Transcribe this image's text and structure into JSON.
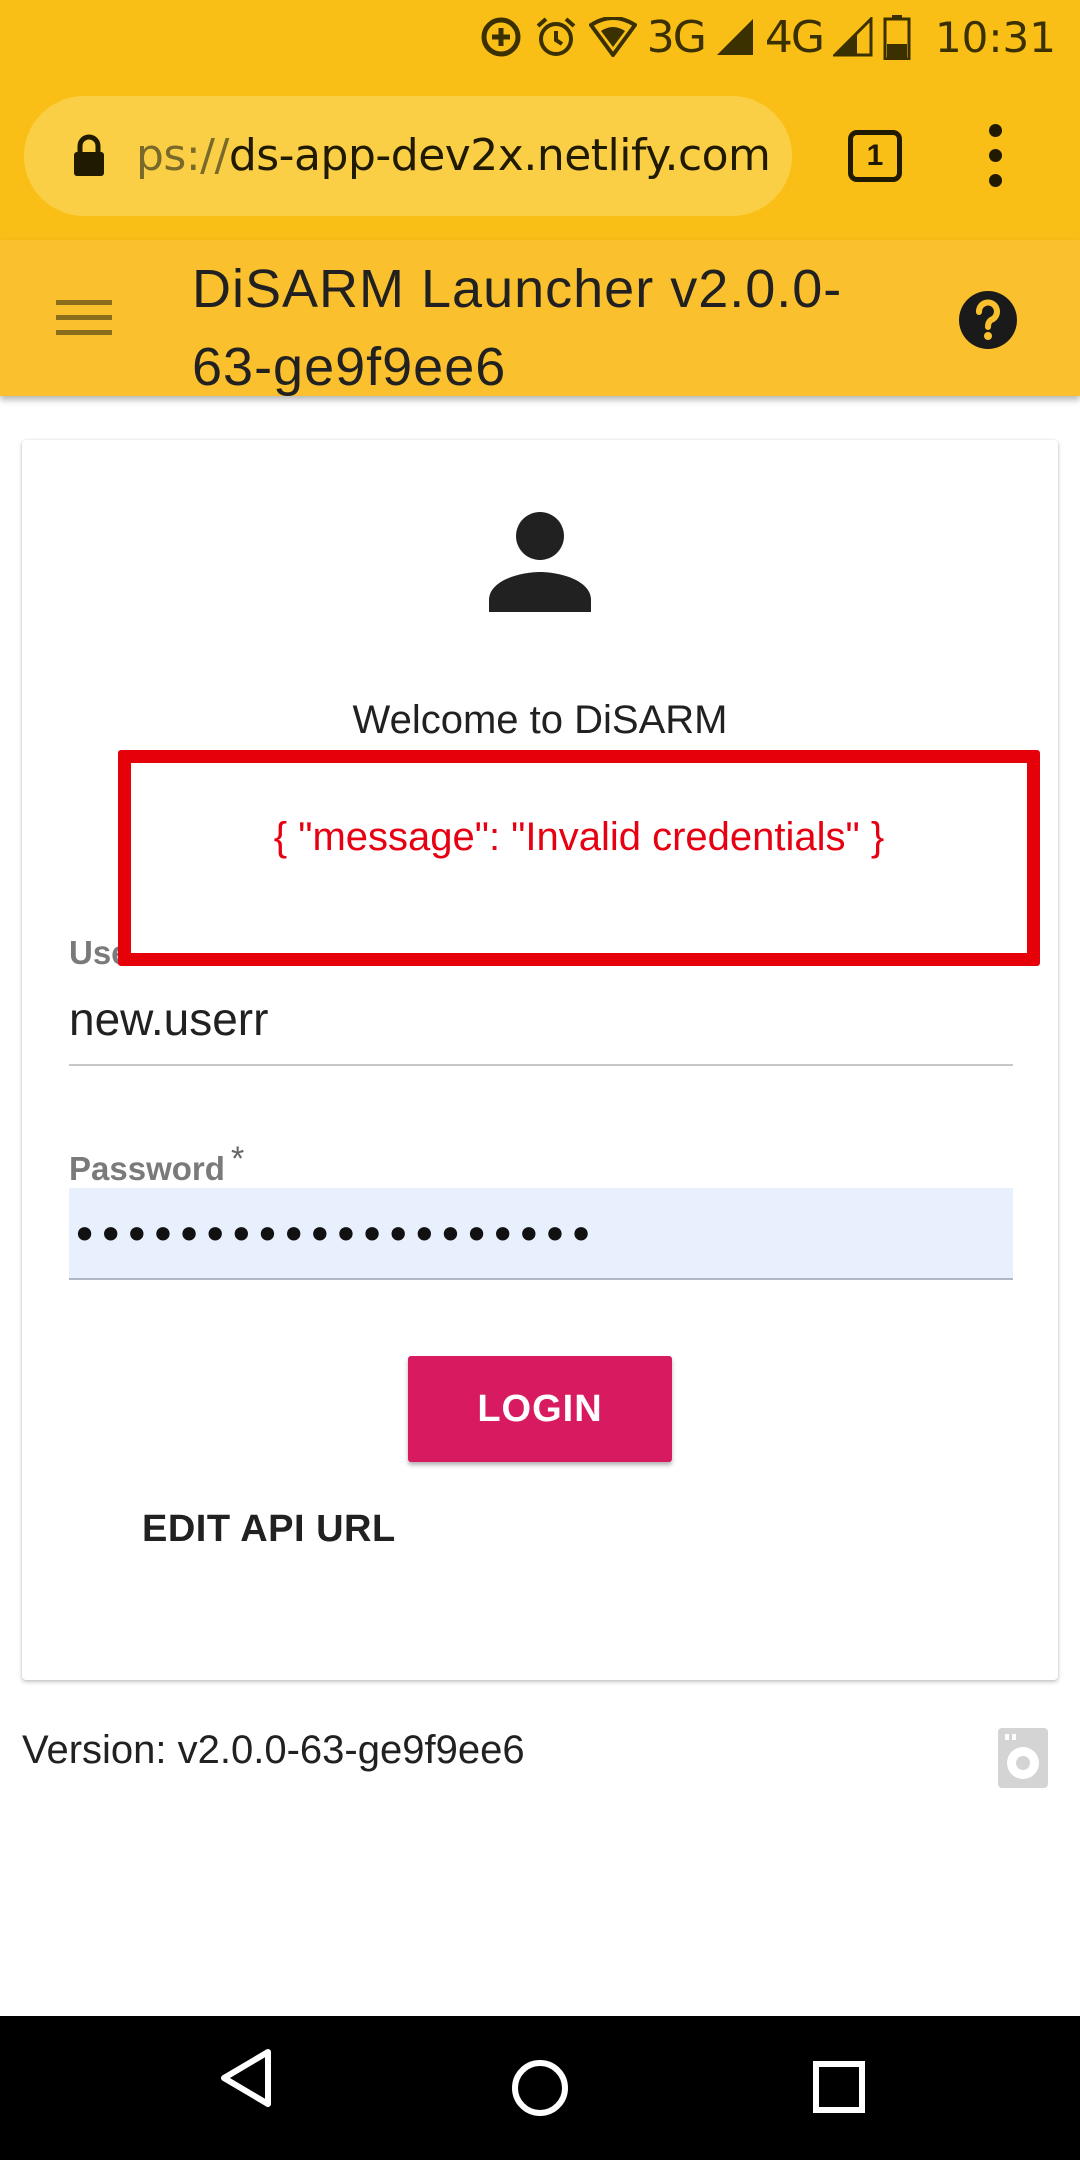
{
  "status_bar": {
    "network_3g": "3G",
    "network_4g": "4G",
    "time": "10:31",
    "icons": [
      "data-saver-icon",
      "alarm-icon",
      "wifi-icon",
      "signal-3g-icon",
      "signal-4g-icon",
      "battery-icon"
    ]
  },
  "browser": {
    "url_scheme": "ps://",
    "url_host": "ds-app-dev2x.netlify.com",
    "tab_count": "1",
    "icons": [
      "lock-icon",
      "tabs-icon",
      "more-vert-icon"
    ]
  },
  "app_bar": {
    "title": "DiSARM Launcher v2.0.0-63-ge9f9ee6",
    "icons": [
      "menu-icon",
      "help-icon"
    ]
  },
  "login_card": {
    "welcome": "Welcome to DiSARM",
    "error_message": "{ \"message\": \"Invalid credentials\" }",
    "username_label": "Username",
    "username_value": "new.userr",
    "password_label": "Password",
    "password_value": "••••••••••••••••••••",
    "required_mark": "*",
    "login_label": "LOGIN",
    "edit_api_label": "EDIT API URL"
  },
  "footer": {
    "version": "Version: v2.0.0-63-ge9f9ee6",
    "icons": [
      "offline-storage-icon"
    ]
  },
  "nav_bar": {
    "icons": [
      "back-icon",
      "home-icon",
      "recents-icon"
    ]
  },
  "colors": {
    "status_bar": "#f9bf16",
    "app_bar": "#fbc02d",
    "login_button": "#d81b60",
    "error": "#e6000a"
  }
}
